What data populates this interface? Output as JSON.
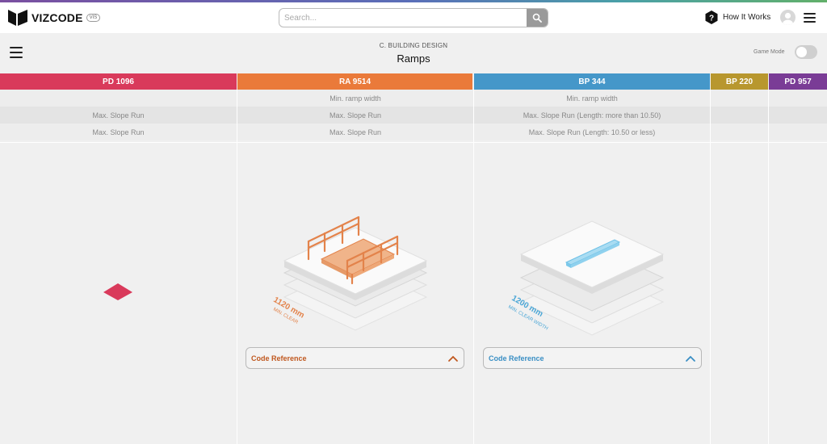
{
  "app": {
    "name": "VIZCODE",
    "badge": "VIS"
  },
  "search": {
    "placeholder": "Search..."
  },
  "header": {
    "how_it_works": "How It Works"
  },
  "page": {
    "breadcrumb": "C. BUILDING DESIGN",
    "title": "Ramps",
    "game_mode_label": "Game Mode",
    "game_mode_on": false
  },
  "columns": [
    {
      "code": "PD 1096",
      "color": "#d93a5b",
      "rows": [
        "",
        "Max. Slope Run",
        "Max. Slope Run"
      ]
    },
    {
      "code": "RA 9514",
      "color": "#ea7a3a",
      "rows": [
        "Min. ramp width",
        "Max. Slope Run",
        "Max. Slope Run"
      ],
      "code_reference": "Code Reference",
      "illustration_label": "1120 mm",
      "illustration_sublabel": "MIN. CLEAR"
    },
    {
      "code": "BP 344",
      "color": "#4597c9",
      "rows": [
        "Min. ramp width",
        "Max. Slope Run (Length: more than 10.50)",
        "Max. Slope Run (Length: 10.50 or less)"
      ],
      "code_reference": "Code Reference",
      "illustration_label": "1200 mm",
      "illustration_sublabel": "MIN. CLEAR WIDTH"
    },
    {
      "code": "BP 220",
      "color": "#b8972e",
      "rows": [
        "",
        "",
        ""
      ]
    },
    {
      "code": "PD 957",
      "color": "#7a3c96",
      "rows": [
        "",
        "",
        ""
      ]
    }
  ],
  "icons": {
    "search": "search-icon",
    "help": "question-hexagon-icon",
    "avatar": "user-avatar-icon",
    "menu": "hamburger-menu-icon",
    "chevron": "chevron-up-icon"
  }
}
